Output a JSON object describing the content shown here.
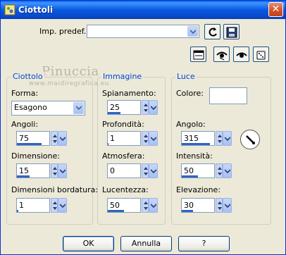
{
  "window": {
    "title": "Ciottoli"
  },
  "preset": {
    "label": "Imp. predef.:",
    "value": ""
  },
  "watermark": {
    "name": "Pinuccia",
    "url": "www.maidiregrafica.eu"
  },
  "groups": {
    "ciottolo": {
      "title": "Ciottolo",
      "forma_label": "Forma:",
      "forma_value": "Esagono",
      "angoli_label": "Angoli:",
      "angoli_value": "75",
      "angoli_level": 0.75,
      "dimensione_label": "Dimensione:",
      "dimensione_value": "15",
      "dimensione_level": 0.4,
      "bordatura_label": "Dimensioni bordatura:",
      "bordatura_value": "1",
      "bordatura_level": 0.05
    },
    "immagine": {
      "title": "Immagine",
      "spianamento_label": "Spianamento:",
      "spianamento_value": "25",
      "spianamento_level": 0.4,
      "profondita_label": "Profondità:",
      "profondita_value": "1",
      "profondita_level": 0.02,
      "atmosfera_label": "Atmosfera:",
      "atmosfera_value": "0",
      "atmosfera_level": 0.0,
      "lucentezza_label": "Lucentezza:",
      "lucentezza_value": "50",
      "lucentezza_level": 0.5
    },
    "luce": {
      "title": "Luce",
      "colore_label": "Colore:",
      "colore_value": "#FFFFFF",
      "angolo_label": "Angolo:",
      "angolo_value": "315",
      "angolo_level": 0.875,
      "intensita_label": "Intensità:",
      "intensita_value": "50",
      "intensita_level": 0.5,
      "elevazione_label": "Elevazione:",
      "elevazione_value": "30",
      "elevazione_level": 0.35
    }
  },
  "buttons": {
    "ok": "OK",
    "cancel": "Annulla",
    "help": "?"
  },
  "colors": {
    "accent": "#3163C5",
    "group_title": "#0046D5",
    "titlebar": "#0A59E0"
  }
}
